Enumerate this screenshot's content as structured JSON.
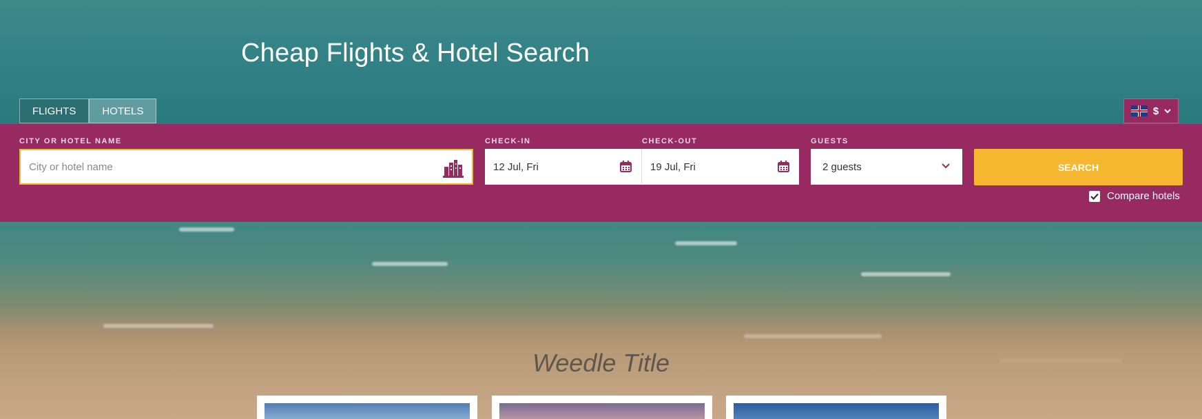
{
  "header": {
    "title": "Cheap Flights & Hotel Search"
  },
  "tabs": [
    {
      "label": "FLIGHTS",
      "active": false
    },
    {
      "label": "HOTELS",
      "active": true
    }
  ],
  "currency": {
    "symbol": "$",
    "flag_icon": "uk-flag-icon"
  },
  "search": {
    "city_label": "CITY OR HOTEL NAME",
    "city_placeholder": "City or hotel name",
    "checkin_label": "CHECK-IN",
    "checkin_value": "12 Jul, Fri",
    "checkout_label": "CHECK-OUT",
    "checkout_value": "19 Jul, Fri",
    "guests_label": "GUESTS",
    "guests_value": "2 guests",
    "button_label": "SEARCH",
    "compare_label": "Compare hotels",
    "compare_checked": true
  },
  "section": {
    "title": "Weedle Title"
  },
  "colors": {
    "brand": "#962a61",
    "accent": "#f5b730",
    "field_border": "#f5b730"
  }
}
